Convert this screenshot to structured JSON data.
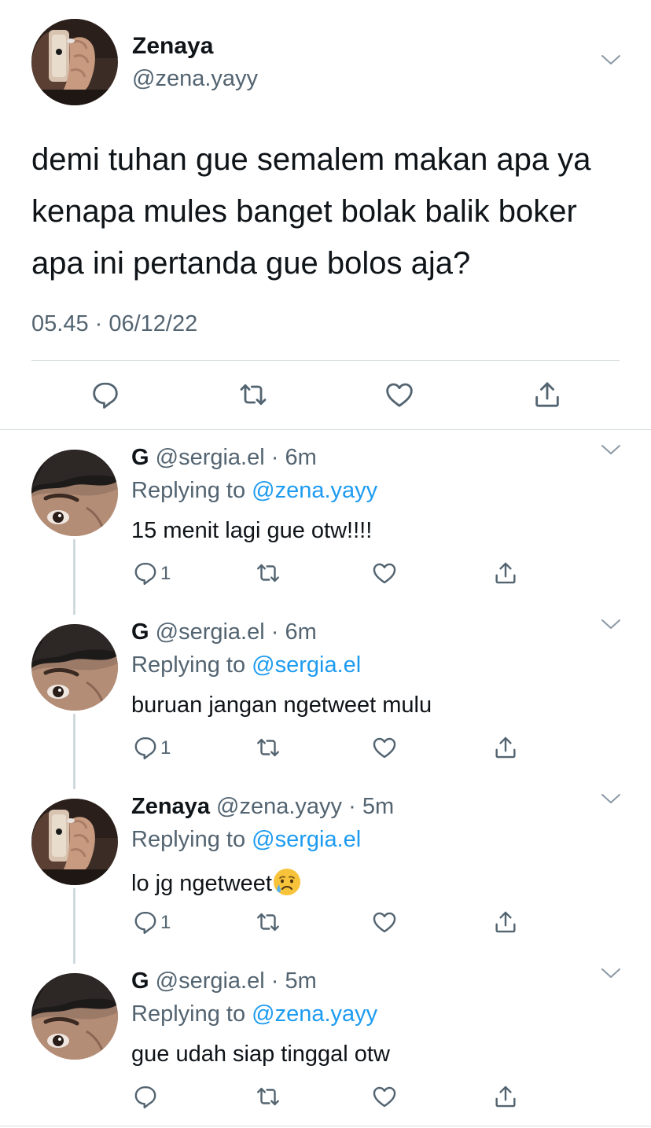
{
  "main_tweet": {
    "author_name": "Zenaya",
    "author_handle": "@zena.yayy",
    "text": "demi tuhan gue semalem makan apa ya kenapa mules banget bolak balik boker apa ini pertanda gue bolos aja?",
    "timestamp": "05.45 · 06/12/22",
    "actions": [
      "reply-icon",
      "retweet-icon",
      "like-icon",
      "share-icon"
    ]
  },
  "replies": [
    {
      "name": "G",
      "handle": "@sergia.el",
      "sep": "·",
      "time": "6m",
      "replying_prefix": "Replying to ",
      "replying_to": "@zena.yayy",
      "text": "15 menit lagi gue otw!!!!",
      "reply_count": "1"
    },
    {
      "name": "G",
      "handle": "@sergia.el",
      "sep": "·",
      "time": "6m",
      "replying_prefix": "Replying to ",
      "replying_to": "@sergia.el",
      "text": "buruan jangan ngetweet mulu",
      "reply_count": "1"
    },
    {
      "name": "Zenaya",
      "handle": "@zena.yayy",
      "sep": "·",
      "time": "5m",
      "replying_prefix": "Replying to ",
      "replying_to": "@sergia.el",
      "text": "lo jg ngetweet",
      "emoji": "crying-face",
      "reply_count": "1"
    },
    {
      "name": "G",
      "handle": "@sergia.el",
      "sep": "·",
      "time": "5m",
      "replying_prefix": "Replying to ",
      "replying_to": "@zena.yayy",
      "text": "gue udah siap tinggal otw",
      "reply_count": ""
    }
  ],
  "colors": {
    "text": "#0f1419",
    "secondary": "#536471",
    "link": "#1d9bf0",
    "divider": "#d8dde1"
  }
}
